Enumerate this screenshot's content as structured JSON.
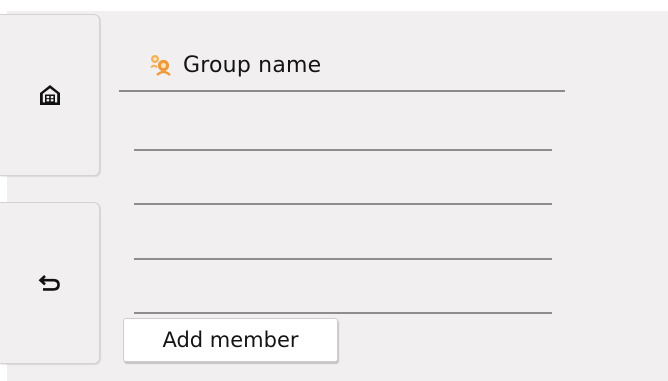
{
  "sidebar": {
    "home": {
      "icon": "home-icon"
    },
    "back": {
      "icon": "back-arrow-icon"
    }
  },
  "group": {
    "icon": "group-members-icon",
    "title": "Group name"
  },
  "members": [
    {
      "label": ""
    },
    {
      "label": ""
    },
    {
      "label": ""
    },
    {
      "label": ""
    }
  ],
  "actions": {
    "add_member_label": "Add member"
  },
  "colors": {
    "panel_background": "#f1efef",
    "group_icon_accent": "#f0a040"
  }
}
